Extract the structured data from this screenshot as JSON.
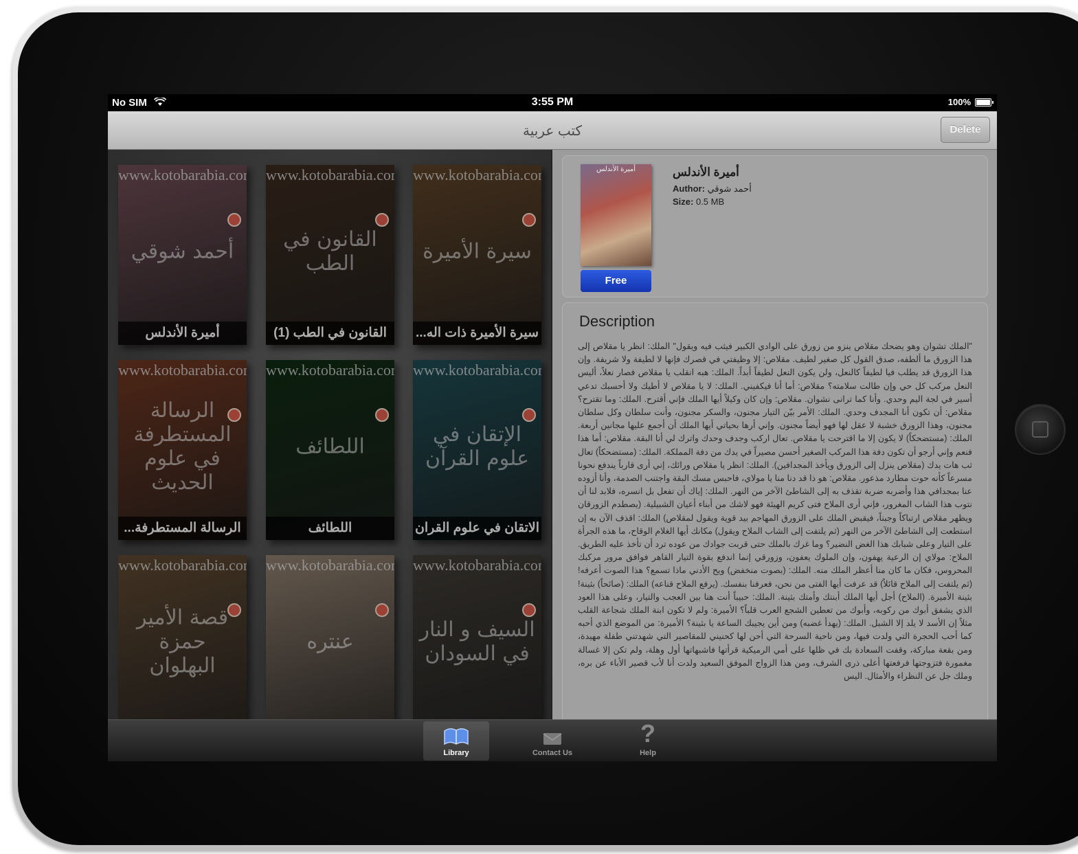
{
  "status_bar": {
    "carrier": "No SIM",
    "time": "3:55 PM",
    "battery": "100%"
  },
  "nav": {
    "title": "كتب عربية",
    "delete_label": "Delete"
  },
  "books": [
    {
      "caption": "أميرة الأندلس",
      "cover_text": "أحمد شوقي",
      "url": "www.kotobarabia.com",
      "color": "#6a4a52"
    },
    {
      "caption": "القانون في الطب (1)",
      "cover_text": "القانون في الطب",
      "url": "www.kotobarabia.com",
      "color": "#3a2a1e"
    },
    {
      "caption": "سيرة الأميرة ذات اله...",
      "cover_text": "سيرة الأميرة",
      "url": "www.kotobarabia.com",
      "color": "#5a4026"
    },
    {
      "caption": "الرسالة المستطرفة...",
      "cover_text": "الرسالة المستطرفة في علوم الحديث",
      "url": "www.kotobarabia.com",
      "color": "#6b3520"
    },
    {
      "caption": "اللطائف",
      "cover_text": "اللطائف",
      "url": "www.kotobarabia.com",
      "color": "#0f2a12"
    },
    {
      "caption": "الاتقان في علوم القران",
      "cover_text": "الإتقان في علوم القرآن",
      "url": "www.kotobarabia.com",
      "color": "#1e4a52"
    },
    {
      "caption": "",
      "cover_text": "قصة الأمير حمزة البهلوان",
      "url": "www.kotobarabia.com",
      "color": "#5b4630"
    },
    {
      "caption": "",
      "cover_text": "عنتره",
      "url": "www.kotobarabia.com",
      "color": "#8a7a6a"
    },
    {
      "caption": "",
      "cover_text": "السيف و النار في السودان",
      "url": "www.kotobarabia.com",
      "color": "#3e3a34"
    }
  ],
  "detail": {
    "book_title": "أميرة الأندلس",
    "author_label": "Author:",
    "author": "أحمد شوقي",
    "size_label": "Size:",
    "size": "0.5 MB",
    "free_label": "Free",
    "description_heading": "Description",
    "description": "\"الملك تشوان وهو يضحك مقلاص ينزو من زورق على الوادي الكبير فيثب فيه ويقول\" الملك: انظر يا مقلاص إلى هذا الزورق ما ألطفه، صدق القول كل صغير لطيف. مقلاص: إلا وظيفتي في قصرك فإنها لا لطيفة ولا شريفة. وإن هذا الزورق قد يطلب فيا لطيفاً كالنعل، ولن يكون النعل لطيفاً أبداً. الملك: هبه انقلب يا مقلاص فصار نعلاً، أليس النعل مركب كل حي وإن طالت سلامته؟ مقلاص: أما أنا فيكفيني. الملك: لا يا مقلاص لا أطيك ولا أحسبك تدعي أسير في لجة اليم وحدي. وأنا كما ترانى نشوان. مقلاص: وإن كان وكيلاً أيها الملك فإني أقترح. الملك: وما تقترح؟ مقلاص: أن تكون أنا المجدف وحدي. الملك: الأمر بيّن التيار مجنون، والسكر مجنون، وأنت سلطان وكل سلطان مجنون، وهذا الزورق خشبة لا عقل لها فهو أيضاً مجنون. وإني أرها بحياتي أيها الملك أن أجمع عليها مجانين أربعة. الملك: (مستضحكاً) لا يكون إلا ما اقترحت يا مقلاص. تعال اركب وجدف وحدك واترك لي أنا البقة. مقلاص: أما هذا فنعم وإني أرجو أن تكون دفة هذا المركب الصغير أحسن مصيراً في يدك من دفة المملكة. الملك: (مستضحكاً) تعال ثب هات يدك (مقلاص ينزل إلى الزورق ويأخذ المجدافين). الملك: انظر يا مقلاص ورائك، إني أرى قارباً يندفع نحونا مسرعاً كأنه حوت مطارد مذعور. مقلاص: هو ذا قد دنا منا يا مولاي، فاحبس مسك البقة واجتنب الصدمة، وأنا أزوده عنا بمجدافي هذا وأضربه ضربة تقذف به إلى الشاطئ الآخر من النهر. الملك: إياك أن تفعل بل انسره، فلابد لنا أن نتوب هذا الشاب المغرور، فإني أرى الملاح فتى كريم الهيئة فهو لاشك من أبناء أعيان الشبيلية. (يصطدم الزورقان ويظهر مقلاص ارتباكاً وجبناً، فيقبض الملك على الزورق المهاجم بيد قوية ويقول لمقلاص) الملك: اقذف الآن به إن استطعت إلى الشاطئ الآخر من النهر (ثم يلتفت إلى الشاب الملاح ويقول) مكانك أيها الغلام الوقاح، ما هذه الجرأة على التيار وعلى شبابك هذا الغض النضير؟ وما غرك بالملك حتى قربت جوادك من عوده ترد أن تأخذ عليه الطريق. الملاح: مولاي إن الرعية يهفون، وإن الملوك يعفون، وزورقي إنما اندفع بقوة التيار القاهر فوافق مرور مركبك المحروس، فكان ما كان منا أعظر الملك منه. الملك: (بصوت منخفض) ويح الأدني ماذا تسمع؟ هذا الصوت أعرفه! (ثم يلتفت إلى الملاح قائلاً) قد عرفت أيها الفتى من نحن، فعرفنا بنفسك. (يرفع الملاح قناعه) الملك: (صائحاً) بثينة! بثينة الأميرة. (الملاح) أجل أيها الملك أبنتك وأمتك بثينة. الملك: حبيباً أنت هنا بين العجب والتيار، وعلى هذا العود الذي يشفق أبوك من ركوبه، وأبوك من تعطين الشجع العرب قلباً؟ الأميرة: ولم لا تكون ابنة الملك شجاعة القلب مثلاً إن الأسد لا يلد إلا الشبل. الملك: (يهدأ غضبه) ومن أين يجيبك الساعة يا بثينة؟ الأميرة: من الموضع الذي أحبه كما أحب الحجرة التي ولدت فيها، ومن ناحية السرحة التي أحن لها كحنيني للمقاصير التي شهدتني طفلة مهيدة، ومن بقعة مباركة، وقفت السعادة بك في ظلها على أمي الرميكية قرأتها فاشبهاتها أول وهلة، ولم تكن إلا غسالة مغمورة فتزوجتها فرفعتها أعلى ذرى الشرف، ومن هذا الزواج الموفق السعيد ولدت أنا لأب قصير الأباء عن بره، وملك جل عن النظراء والأمثال. اليس"
  },
  "tabs": [
    {
      "label": "Library",
      "icon": "library-icon",
      "active": true
    },
    {
      "label": "Contact Us",
      "icon": "contact-icon",
      "active": false
    },
    {
      "label": "Help",
      "icon": "help-icon",
      "active": false
    }
  ]
}
